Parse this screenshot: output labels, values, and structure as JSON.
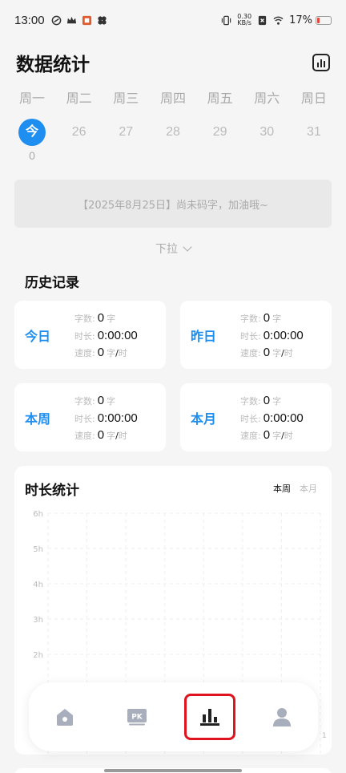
{
  "status": {
    "time": "13:00",
    "net_speed_value": "0.30",
    "net_speed_unit": "KB/s",
    "battery": "17%"
  },
  "header": {
    "title": "数据统计"
  },
  "week": {
    "weekdays": [
      "周一",
      "周二",
      "周三",
      "周四",
      "周五",
      "周六",
      "周日"
    ],
    "dates": [
      "今",
      "26",
      "27",
      "28",
      "29",
      "30",
      "31"
    ],
    "today_count": "0"
  },
  "notice": {
    "text": "【2025年8月25日】尚未码字，加油哦~"
  },
  "pull_down": {
    "label": "下拉"
  },
  "history": {
    "title": "历史记录",
    "field_words": "字数:",
    "field_duration": "时长:",
    "field_speed": "速度:",
    "unit_char": "字",
    "unit_hour": "时",
    "slash": "/",
    "cards": [
      {
        "label": "今日",
        "words": "0",
        "duration": "0:00:00",
        "speed": "0"
      },
      {
        "label": "昨日",
        "words": "0",
        "duration": "0:00:00",
        "speed": "0"
      },
      {
        "label": "本周",
        "words": "0",
        "duration": "0:00:00",
        "speed": "0"
      },
      {
        "label": "本月",
        "words": "0",
        "duration": "0:00:00",
        "speed": "0"
      }
    ]
  },
  "duration_chart": {
    "title": "时长统计",
    "tab_week": "本周",
    "tab_month": "本月"
  },
  "chart_data": {
    "type": "bar",
    "title": "时长统计",
    "y_ticks": [
      "6h",
      "5h",
      "4h",
      "3h",
      "2h"
    ],
    "ylim": [
      0,
      6
    ],
    "values": [],
    "grid": true,
    "partial_label": "1"
  },
  "tabbar": {
    "items": [
      "home-icon",
      "pk-icon",
      "stats-icon",
      "profile-icon"
    ],
    "pk_text": "PK",
    "active_index": 2,
    "active_color": "#222222",
    "inactive_color": "#a8aebc",
    "highlight_color": "#e0141e"
  },
  "colors": {
    "accent": "#1e8ef0"
  }
}
